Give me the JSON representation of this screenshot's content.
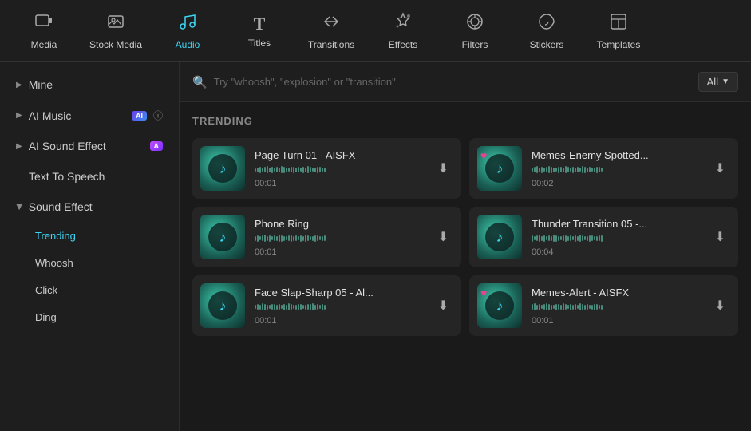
{
  "nav": {
    "items": [
      {
        "id": "media",
        "label": "Media",
        "icon": "🎞",
        "active": false
      },
      {
        "id": "stock-media",
        "label": "Stock Media",
        "icon": "🖼",
        "active": false
      },
      {
        "id": "audio",
        "label": "Audio",
        "icon": "♪",
        "active": true
      },
      {
        "id": "titles",
        "label": "Titles",
        "icon": "T",
        "active": false
      },
      {
        "id": "transitions",
        "label": "Transitions",
        "icon": "↔",
        "active": false
      },
      {
        "id": "effects",
        "label": "Effects",
        "icon": "✦",
        "active": false
      },
      {
        "id": "filters",
        "label": "Filters",
        "icon": "⊕",
        "active": false
      },
      {
        "id": "stickers",
        "label": "Stickers",
        "icon": "❖",
        "active": false
      },
      {
        "id": "templates",
        "label": "Templates",
        "icon": "⬜",
        "active": false
      }
    ]
  },
  "sidebar": {
    "mine_label": "Mine",
    "ai_music_label": "AI Music",
    "ai_sound_effect_label": "AI Sound Effect",
    "text_to_speech_label": "Text To Speech",
    "sound_effect_label": "Sound Effect",
    "sub_items": [
      {
        "id": "trending",
        "label": "Trending",
        "active": true
      },
      {
        "id": "whoosh",
        "label": "Whoosh",
        "active": false
      },
      {
        "id": "click",
        "label": "Click",
        "active": false
      },
      {
        "id": "ding",
        "label": "Ding",
        "active": false
      }
    ]
  },
  "search": {
    "placeholder": "Try \"whoosh\", \"explosion\" or \"transition\"",
    "filter_label": "All"
  },
  "content": {
    "section_title": "TRENDING",
    "items": [
      {
        "id": 1,
        "name": "Page Turn 01 - AISFX",
        "duration": "00:01",
        "has_heart": false,
        "waveform_heights": [
          4,
          6,
          8,
          5,
          7,
          9,
          6,
          8,
          5,
          7,
          6,
          9,
          8,
          6,
          5,
          7,
          8,
          6,
          7,
          5,
          8,
          6,
          9,
          7,
          5,
          6,
          8,
          7,
          5,
          6
        ]
      },
      {
        "id": 2,
        "name": "Memes-Enemy Spotted...",
        "duration": "00:02",
        "has_heart": true,
        "waveform_heights": [
          5,
          7,
          9,
          6,
          8,
          5,
          7,
          9,
          8,
          6,
          5,
          8,
          7,
          6,
          9,
          7,
          5,
          8,
          6,
          7,
          5,
          9,
          8,
          6,
          7,
          5,
          6,
          8,
          7,
          5
        ]
      },
      {
        "id": 3,
        "name": "Phone Ring",
        "duration": "00:01",
        "has_heart": false,
        "waveform_heights": [
          6,
          8,
          5,
          7,
          9,
          6,
          8,
          5,
          7,
          6,
          9,
          8,
          6,
          5,
          7,
          8,
          6,
          7,
          5,
          8,
          6,
          9,
          7,
          5,
          6,
          8,
          7,
          5,
          6,
          7
        ]
      },
      {
        "id": 4,
        "name": "Thunder Transition 05 -...",
        "duration": "00:04",
        "has_heart": false,
        "waveform_heights": [
          8,
          5,
          7,
          9,
          6,
          8,
          5,
          7,
          6,
          9,
          8,
          6,
          5,
          7,
          8,
          6,
          7,
          5,
          8,
          6,
          9,
          7,
          5,
          6,
          8,
          7,
          5,
          6,
          7,
          8
        ]
      },
      {
        "id": 5,
        "name": "Face Slap-Sharp 05 - Al...",
        "duration": "00:01",
        "has_heart": false,
        "waveform_heights": [
          5,
          7,
          6,
          9,
          8,
          6,
          5,
          7,
          8,
          6,
          7,
          5,
          8,
          6,
          9,
          7,
          5,
          6,
          8,
          7,
          5,
          6,
          7,
          8,
          9,
          6,
          7,
          5,
          8,
          6
        ]
      },
      {
        "id": 6,
        "name": "Memes-Alert - AISFX",
        "duration": "00:01",
        "has_heart": true,
        "waveform_heights": [
          7,
          9,
          6,
          8,
          5,
          7,
          9,
          8,
          6,
          5,
          8,
          7,
          6,
          9,
          7,
          5,
          8,
          6,
          7,
          5,
          9,
          8,
          6,
          7,
          5,
          6,
          8,
          7,
          5,
          6
        ]
      }
    ]
  }
}
